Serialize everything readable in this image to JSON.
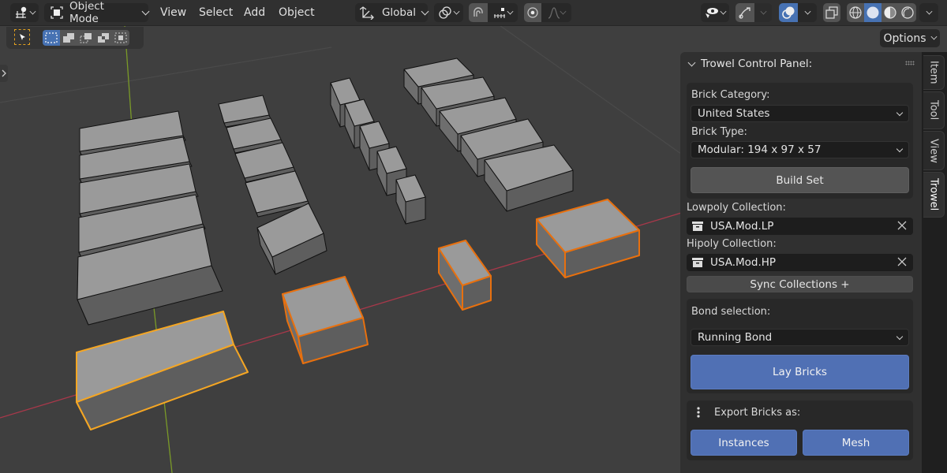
{
  "header": {
    "editor_type_icon": "3d-viewport-icon",
    "mode": "Object Mode",
    "menus": [
      "View",
      "Select",
      "Add",
      "Object"
    ],
    "transform_orientation": "Global",
    "pivot_icon": "pivot-point-icon",
    "snap_icon": "magnet-icon",
    "snap_target_icon": "snap-increment-icon",
    "proportional_edit_icon": "proportional-editing-icon",
    "falloff_icon": "falloff-curve-icon",
    "visibility_icon": "eye-icon",
    "gizmo_icon": "gizmo-icon",
    "overlay_icon": "overlay-icon",
    "xray_icon": "xray-icon",
    "shading_modes": [
      "wireframe",
      "solid",
      "material-preview",
      "rendered"
    ],
    "active_shading": "solid"
  },
  "toolbar": {
    "tool_icon": "select-tool-icon",
    "selection_modes": [
      "set",
      "extend",
      "subtract",
      "difference",
      "intersect"
    ],
    "active_selection_mode": "set"
  },
  "options_label": "Options",
  "sidebar": {
    "tabs": [
      "Item",
      "Tool",
      "View",
      "Trowel"
    ],
    "active_tab": "Trowel",
    "panel_title": "Trowel Control Panel:",
    "brick_category_label": "Brick Category:",
    "brick_category_value": "United States",
    "brick_type_label": "Brick Type:",
    "brick_type_value": "Modular: 194 x 97 x 57",
    "build_set_label": "Build Set",
    "lowpoly_label": "Lowpoly Collection:",
    "lowpoly_value": "USA.Mod.LP",
    "hipoly_label": "Hipoly Collection:",
    "hipoly_value": "USA.Mod.HP",
    "sync_label": "Sync Collections +",
    "bond_label": "Bond selection:",
    "bond_value": "Running Bond",
    "lay_bricks_label": "Lay Bricks",
    "export_label": "Export Bricks as:",
    "instances_label": "Instances",
    "mesh_label": "Mesh"
  },
  "colors": {
    "accent_blue": "#4772b3",
    "button_blue": "#5070b4",
    "selected_active": "#f5a623",
    "selected": "#e8700e",
    "x_axis": "#a8384a",
    "y_axis": "#7a9a28"
  }
}
